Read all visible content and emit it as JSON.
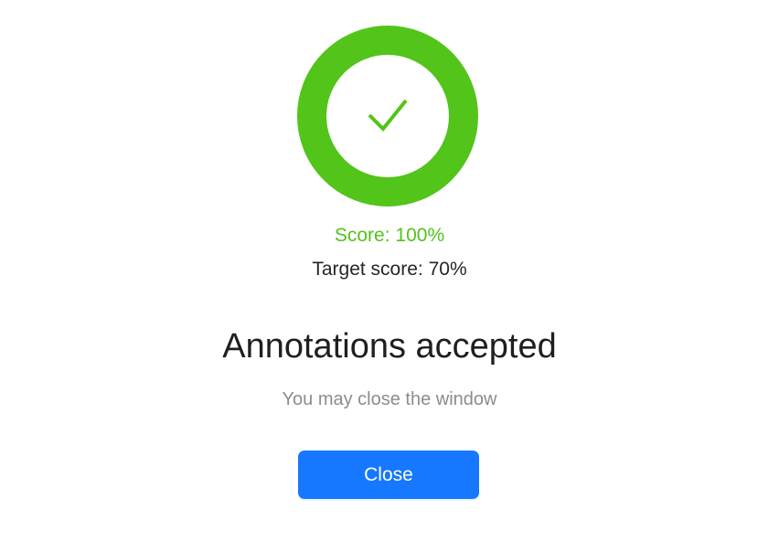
{
  "result": {
    "status_icon": "check-icon",
    "progress_percent": 100,
    "score_text": "Score: 100%",
    "target_score_text": "Target score: 70%",
    "title": "Annotations accepted",
    "subtitle": "You may close the window"
  },
  "actions": {
    "close_label": "Close"
  },
  "colors": {
    "success": "#52c41a",
    "primary": "#1677ff",
    "title_text": "#1f1f1f",
    "secondary_text": "#8c8c8c"
  }
}
